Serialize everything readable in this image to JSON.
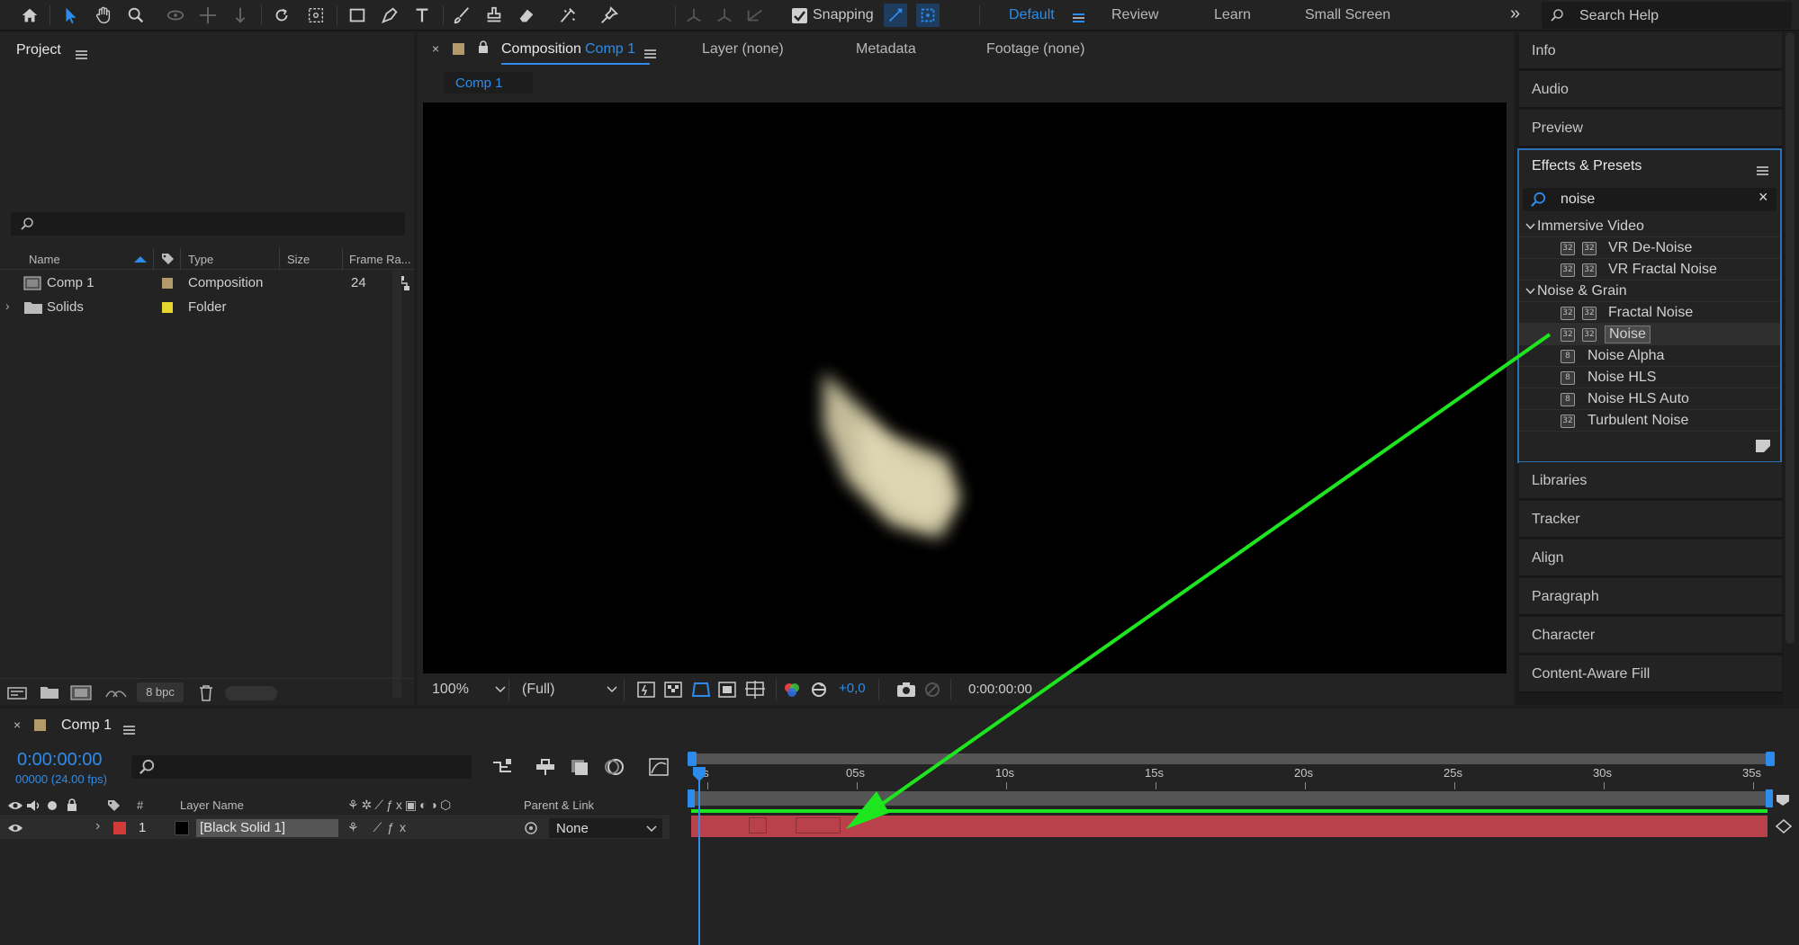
{
  "toolbar": {
    "snapping_label": "Snapping",
    "workspaces": [
      "Default",
      "Review",
      "Learn",
      "Small Screen"
    ],
    "search_placeholder": "Search Help"
  },
  "project": {
    "title": "Project",
    "columns": [
      "Name",
      "Type",
      "Size",
      "Frame Ra..."
    ],
    "rows": [
      {
        "name": "Comp 1",
        "type": "Composition",
        "frame_rate": "24",
        "label_color": "#b39a6b"
      },
      {
        "name": "Solids",
        "type": "Folder",
        "frame_rate": "",
        "label_color": "#e8d630"
      }
    ],
    "bpc": "8 bpc"
  },
  "composition": {
    "tab_prefix": "Composition",
    "tab_name": "Comp 1",
    "other_tabs": [
      "Layer (none)",
      "Metadata",
      "Footage (none)"
    ],
    "subtab": "Comp 1",
    "zoom": "100%",
    "resolution": "(Full)",
    "exposure": "+0,0",
    "timecode": "0:00:00:00"
  },
  "right_panels": {
    "top": [
      "Info",
      "Audio",
      "Preview"
    ],
    "bottom": [
      "Libraries",
      "Tracker",
      "Align",
      "Paragraph",
      "Character",
      "Content-Aware Fill"
    ]
  },
  "effects_presets": {
    "title": "Effects & Presets",
    "search_value": "noise",
    "categories": [
      {
        "name": "Immersive Video",
        "items": [
          "VR De-Noise",
          "VR Fractal Noise"
        ]
      },
      {
        "name": "Noise & Grain",
        "items": [
          "Fractal Noise",
          "Noise",
          "Noise Alpha",
          "Noise HLS",
          "Noise HLS Auto",
          "Turbulent Noise"
        ]
      }
    ],
    "badges": {
      "b32": "32",
      "b8": "8"
    }
  },
  "timeline": {
    "title": "Comp 1",
    "timecode": "0:00:00:00",
    "frame_info": "00000 (24.00 fps)",
    "columns": {
      "num": "#",
      "layer_name": "Layer Name",
      "parent": "Parent & Link"
    },
    "layer": {
      "index": "1",
      "name": "[Black Solid 1]",
      "parent": "None",
      "label_color": "#d33a3a"
    },
    "ticks": [
      "0s",
      "05s",
      "10s",
      "15s",
      "20s",
      "25s",
      "30s",
      "35s"
    ]
  },
  "colors": {
    "accent": "#2d8ceb",
    "annotation_arrow": "#1ee61e",
    "layer_bar": "#b8414c"
  },
  "icons": [
    "home-icon",
    "selection-tool-icon",
    "hand-tool-icon",
    "zoom-tool-icon",
    "rotate-tool-icon",
    "text-tool-icon",
    "pen-tool-icon",
    "search-icon",
    "folder-icon",
    "trash-icon",
    "eye-icon",
    "audio-icon",
    "lock-icon",
    "camera-icon"
  ]
}
